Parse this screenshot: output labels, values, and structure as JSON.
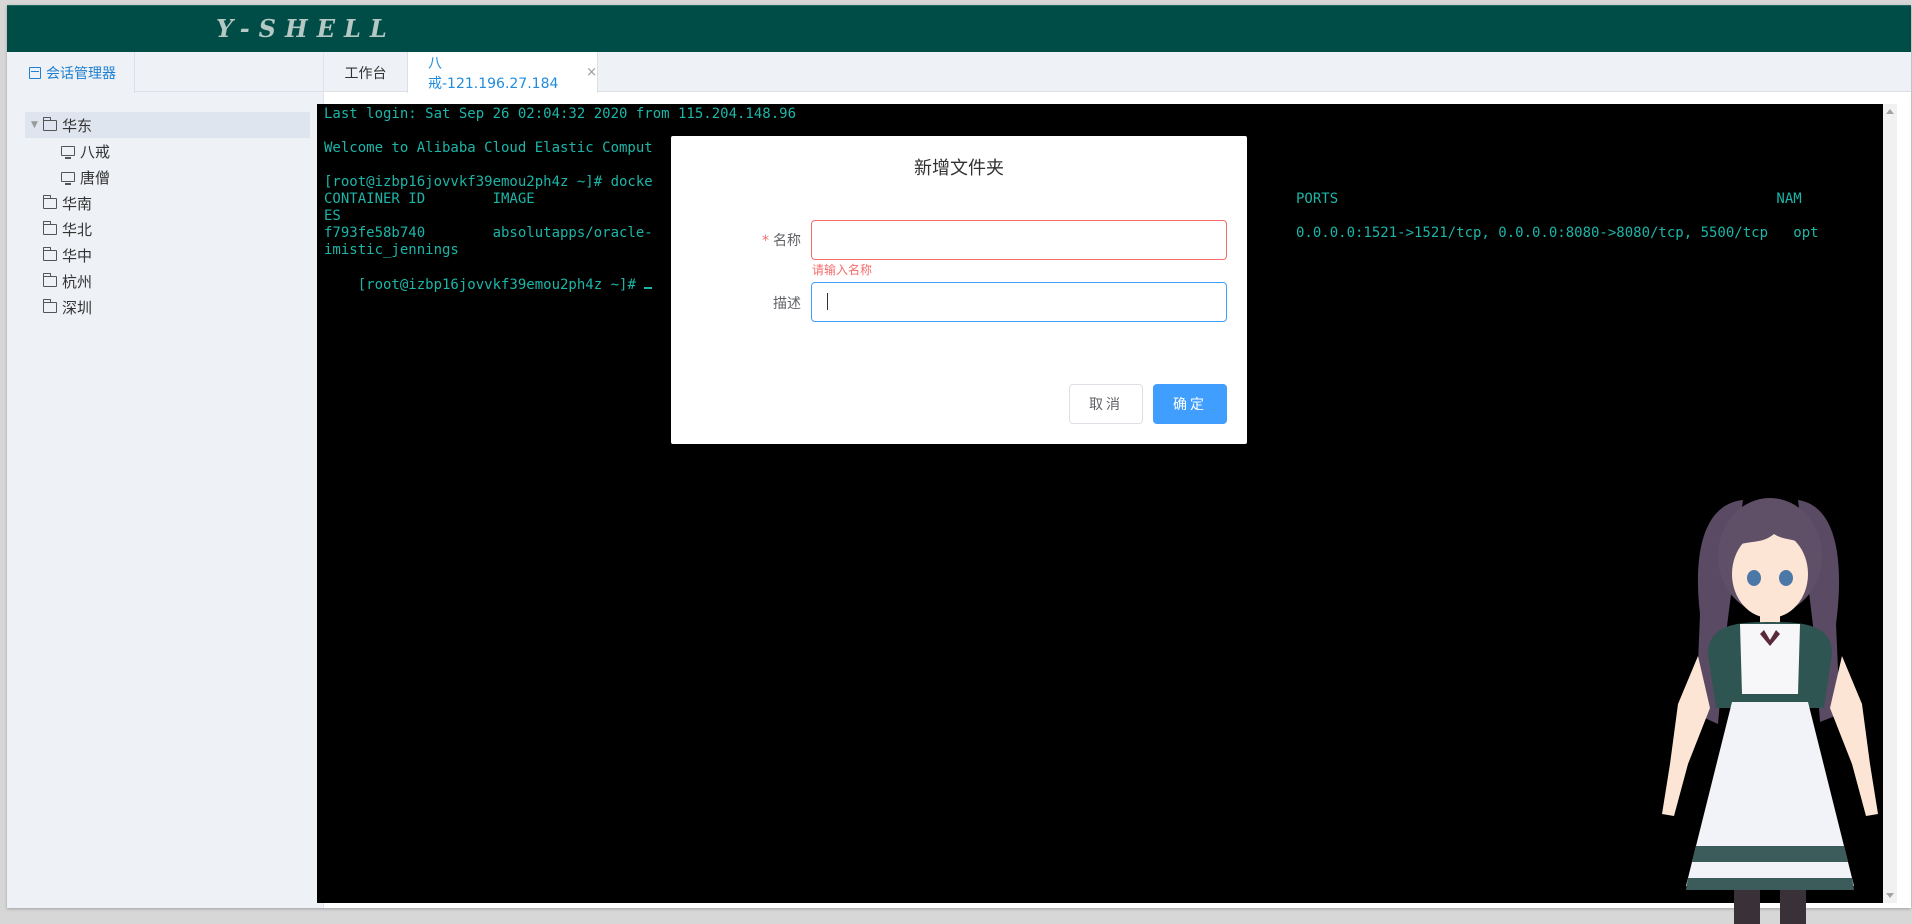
{
  "app": {
    "brand": "Y-SHELL"
  },
  "sidebar": {
    "tab_label": "会话管理器",
    "tree": [
      {
        "label": "华东",
        "type": "folder",
        "expanded": true,
        "selected": true
      },
      {
        "label": "八戒",
        "type": "host"
      },
      {
        "label": "唐僧",
        "type": "host"
      },
      {
        "label": "华南",
        "type": "folder"
      },
      {
        "label": "华北",
        "type": "folder"
      },
      {
        "label": "华中",
        "type": "folder"
      },
      {
        "label": "杭州",
        "type": "folder"
      },
      {
        "label": "深圳",
        "type": "folder"
      }
    ]
  },
  "tabs": {
    "workbench": "工作台",
    "session": "八戒-121.196.27.184",
    "close": "×"
  },
  "terminal": {
    "lines": [
      "Last login: Sat Sep 26 02:04:32 2020 from 115.204.148.96",
      "",
      "Welcome to Alibaba Cloud Elastic Comput",
      "",
      "[root@izbp16jovvkf39emou2ph4z ~]# docke",
      "CONTAINER ID        IMAGE",
      "ES",
      "f793fe58b740        absolutapps/oracle-",
      "imistic_jennings",
      "[root@izbp16jovvkf39emou2ph4z ~]# "
    ],
    "right_lines": [
      "PORTS                                                    NAM",
      "",
      "0.0.0.0:1521->1521/tcp, 0.0.0.0:8080->8080/tcp, 5500/tcp   opt"
    ]
  },
  "dialog": {
    "title": "新增文件夹",
    "name_label": "名称",
    "name_required_mark": "*",
    "name_value": "",
    "name_error": "请输入名称",
    "desc_label": "描述",
    "desc_value": "",
    "cancel_label": "取消",
    "ok_label": "确定"
  },
  "colors": {
    "topbar": "#004d47",
    "terminal_text": "#1cb5a8",
    "primary": "#409eff",
    "error": "#f56c6c"
  }
}
